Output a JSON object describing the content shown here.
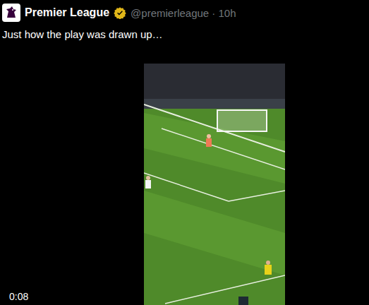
{
  "tweet": {
    "author": {
      "name": "Premier League",
      "verified": true,
      "handle_time": "@premierleague · 10h"
    },
    "text": "Just how the play was drawn up…",
    "video": {
      "duration": "0:08"
    }
  }
}
